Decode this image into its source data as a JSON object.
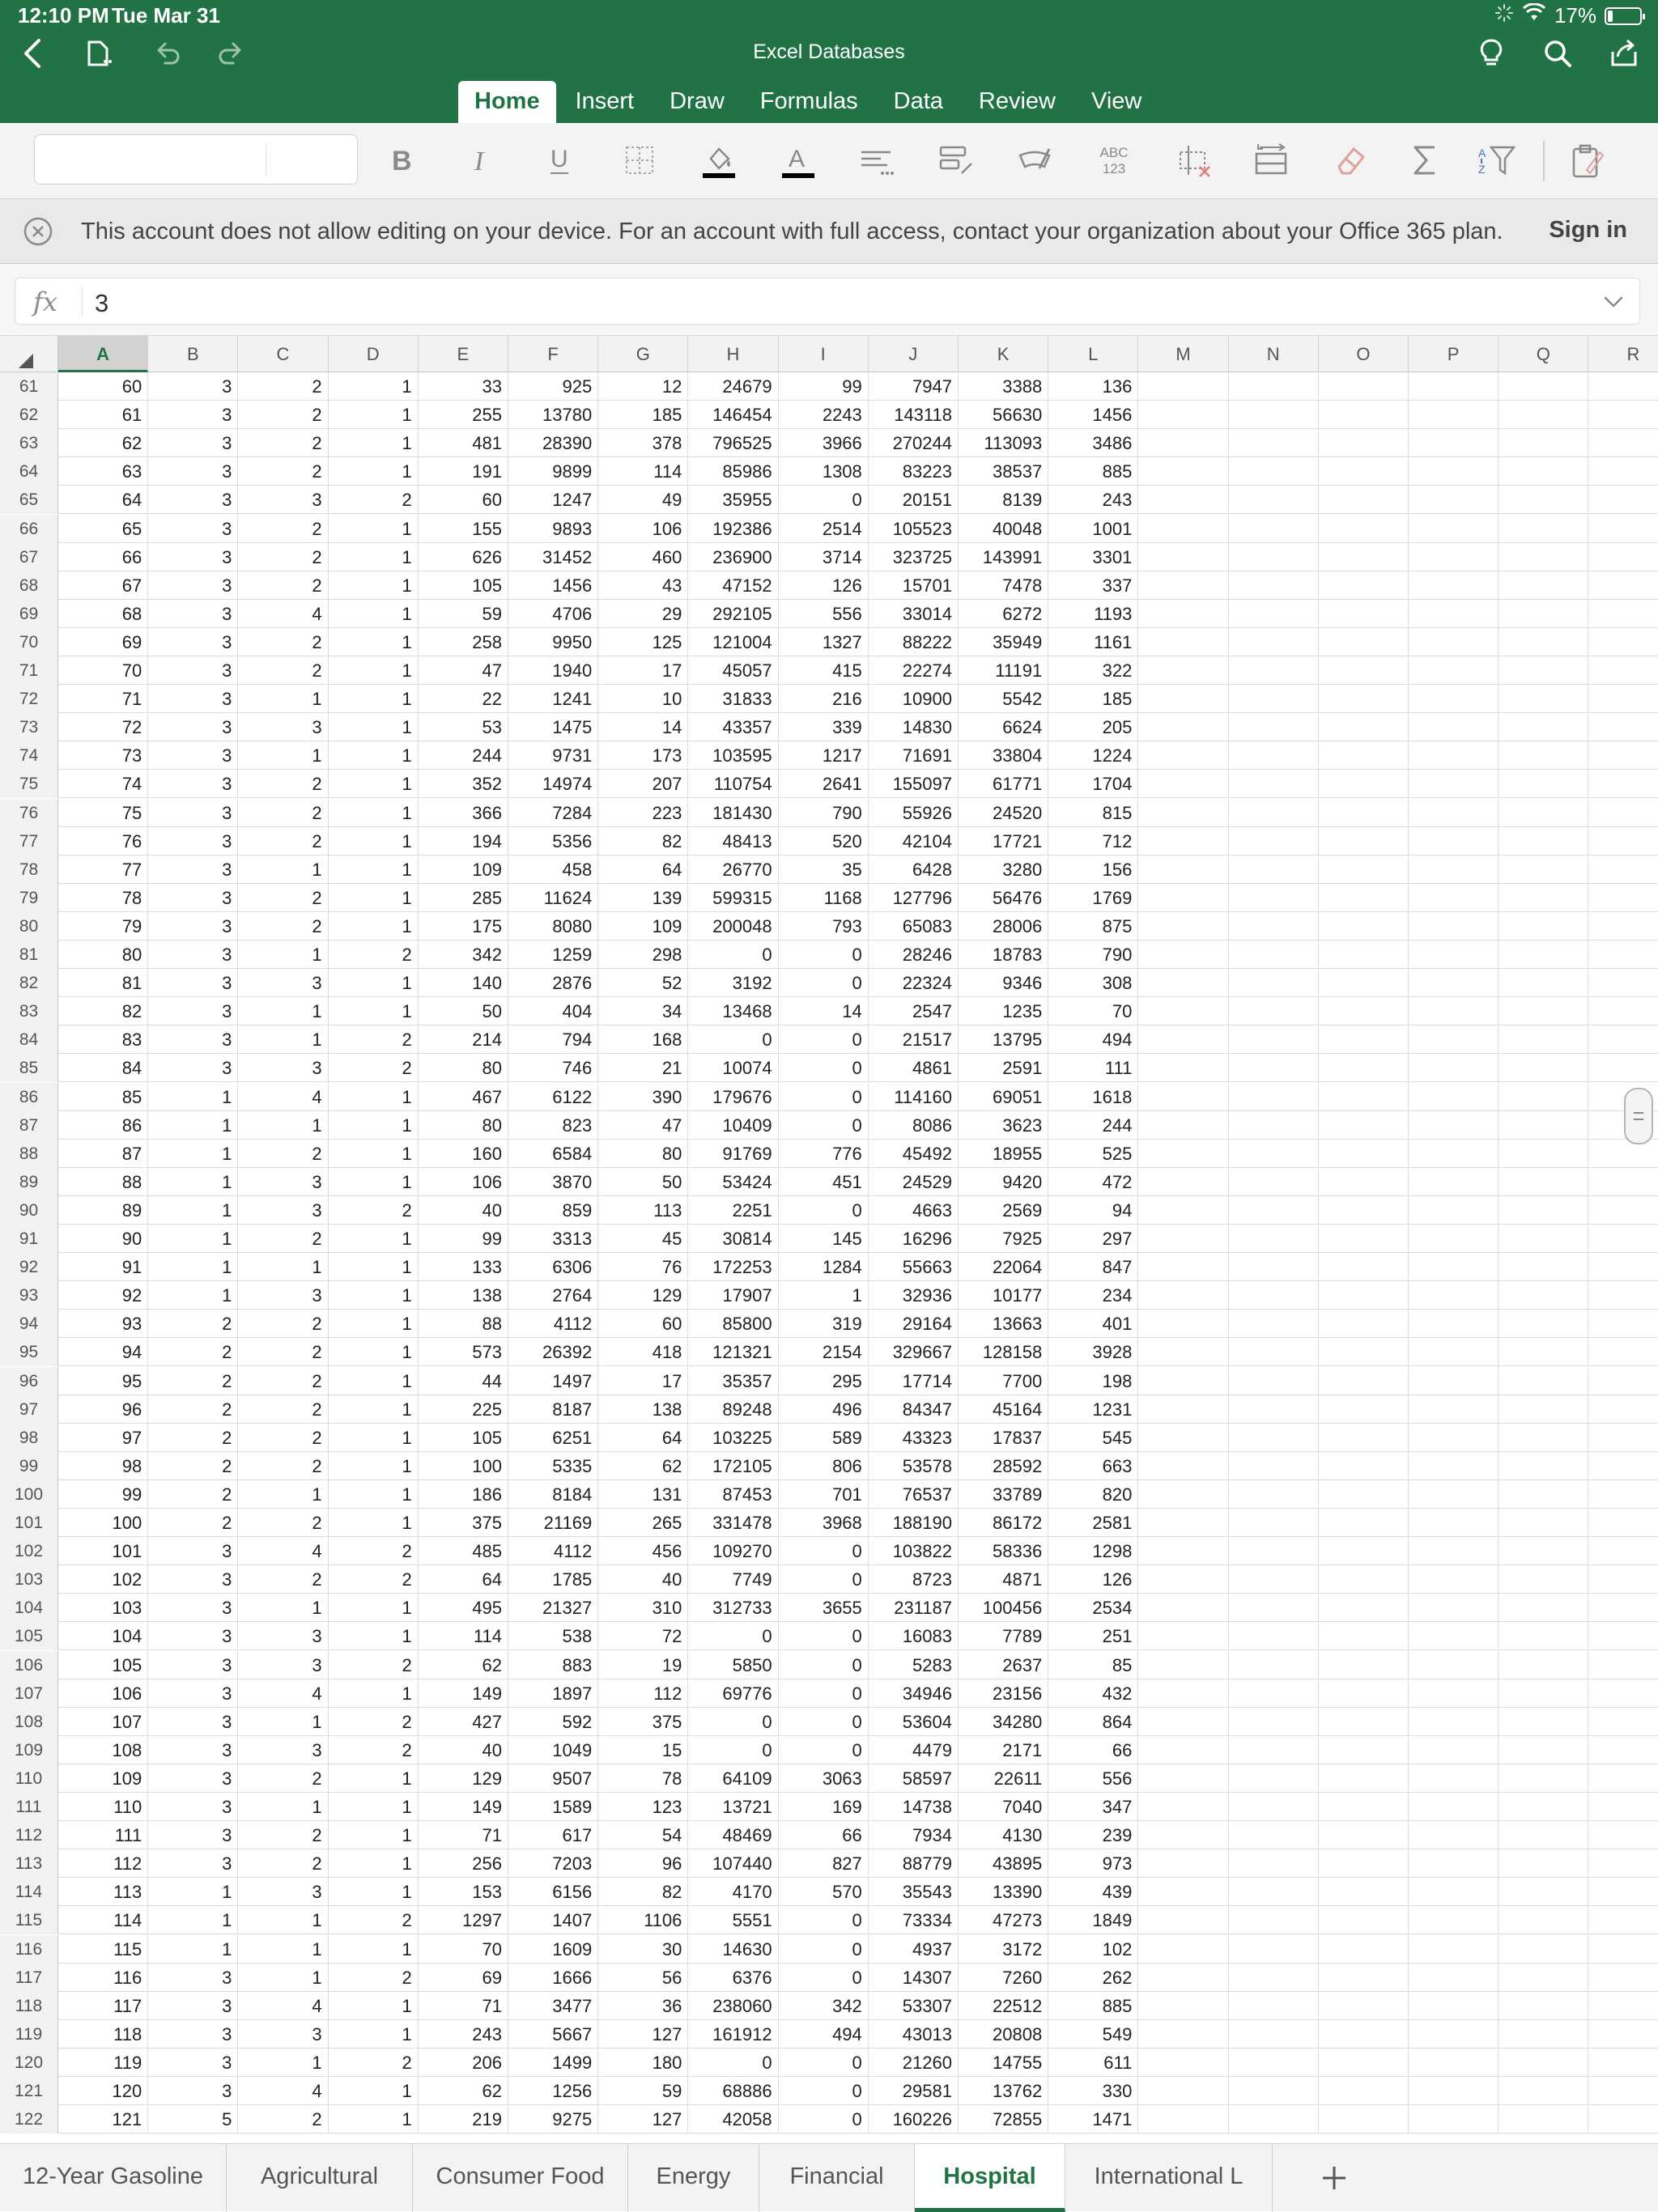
{
  "status_bar": {
    "time": "12:10 PM",
    "date": "Tue Mar 31",
    "battery": "17%",
    "battery_level": 0.17
  },
  "app": {
    "title": "Excel Databases"
  },
  "ribbon": {
    "tabs": [
      "Home",
      "Insert",
      "Draw",
      "Formulas",
      "Data",
      "Review",
      "View"
    ],
    "active": "Home"
  },
  "toolbar": {
    "abc_label_top": "ABC",
    "abc_label_bottom": "123",
    "colors": {
      "fill": "#000000",
      "font": "#000000"
    }
  },
  "notice": {
    "text": "This account does not allow editing on your device. For an account with full access, contact your organization about your Office 365 plan.",
    "sign_in": "Sign in"
  },
  "formula_bar": {
    "fx": "fx",
    "value": "3"
  },
  "grid": {
    "columns": [
      "A",
      "B",
      "C",
      "D",
      "E",
      "F",
      "G",
      "H",
      "I",
      "J",
      "K",
      "L",
      "M",
      "N",
      "O",
      "P",
      "Q",
      "R"
    ],
    "selected_column": "A",
    "rows": [
      {
        "n": 61,
        "v": [
          60,
          3,
          2,
          1,
          33,
          925,
          12,
          24679,
          99,
          7947,
          3388,
          136
        ]
      },
      {
        "n": 62,
        "v": [
          61,
          3,
          2,
          1,
          255,
          13780,
          185,
          146454,
          2243,
          143118,
          56630,
          1456
        ]
      },
      {
        "n": 63,
        "v": [
          62,
          3,
          2,
          1,
          481,
          28390,
          378,
          796525,
          3966,
          270244,
          113093,
          3486
        ]
      },
      {
        "n": 64,
        "v": [
          63,
          3,
          2,
          1,
          191,
          9899,
          114,
          85986,
          1308,
          83223,
          38537,
          885
        ]
      },
      {
        "n": 65,
        "v": [
          64,
          3,
          3,
          2,
          60,
          1247,
          49,
          35955,
          0,
          20151,
          8139,
          243
        ]
      },
      {
        "n": 66,
        "v": [
          65,
          3,
          2,
          1,
          155,
          9893,
          106,
          192386,
          2514,
          105523,
          40048,
          1001
        ]
      },
      {
        "n": 67,
        "v": [
          66,
          3,
          2,
          1,
          626,
          31452,
          460,
          236900,
          3714,
          323725,
          143991,
          3301
        ]
      },
      {
        "n": 68,
        "v": [
          67,
          3,
          2,
          1,
          105,
          1456,
          43,
          47152,
          126,
          15701,
          7478,
          337
        ]
      },
      {
        "n": 69,
        "v": [
          68,
          3,
          4,
          1,
          59,
          4706,
          29,
          292105,
          556,
          33014,
          6272,
          1193
        ]
      },
      {
        "n": 70,
        "v": [
          69,
          3,
          2,
          1,
          258,
          9950,
          125,
          121004,
          1327,
          88222,
          35949,
          1161
        ]
      },
      {
        "n": 71,
        "v": [
          70,
          3,
          2,
          1,
          47,
          1940,
          17,
          45057,
          415,
          22274,
          11191,
          322
        ]
      },
      {
        "n": 72,
        "v": [
          71,
          3,
          1,
          1,
          22,
          1241,
          10,
          31833,
          216,
          10900,
          5542,
          185
        ]
      },
      {
        "n": 73,
        "v": [
          72,
          3,
          3,
          1,
          53,
          1475,
          14,
          43357,
          339,
          14830,
          6624,
          205
        ]
      },
      {
        "n": 74,
        "v": [
          73,
          3,
          1,
          1,
          244,
          9731,
          173,
          103595,
          1217,
          71691,
          33804,
          1224
        ]
      },
      {
        "n": 75,
        "v": [
          74,
          3,
          2,
          1,
          352,
          14974,
          207,
          110754,
          2641,
          155097,
          61771,
          1704
        ]
      },
      {
        "n": 76,
        "v": [
          75,
          3,
          2,
          1,
          366,
          7284,
          223,
          181430,
          790,
          55926,
          24520,
          815
        ]
      },
      {
        "n": 77,
        "v": [
          76,
          3,
          2,
          1,
          194,
          5356,
          82,
          48413,
          520,
          42104,
          17721,
          712
        ]
      },
      {
        "n": 78,
        "v": [
          77,
          3,
          1,
          1,
          109,
          458,
          64,
          26770,
          35,
          6428,
          3280,
          156
        ]
      },
      {
        "n": 79,
        "v": [
          78,
          3,
          2,
          1,
          285,
          11624,
          139,
          599315,
          1168,
          127796,
          56476,
          1769
        ]
      },
      {
        "n": 80,
        "v": [
          79,
          3,
          2,
          1,
          175,
          8080,
          109,
          200048,
          793,
          65083,
          28006,
          875
        ]
      },
      {
        "n": 81,
        "v": [
          80,
          3,
          1,
          2,
          342,
          1259,
          298,
          0,
          0,
          28246,
          18783,
          790
        ]
      },
      {
        "n": 82,
        "v": [
          81,
          3,
          3,
          1,
          140,
          2876,
          52,
          3192,
          0,
          22324,
          9346,
          308
        ]
      },
      {
        "n": 83,
        "v": [
          82,
          3,
          1,
          1,
          50,
          404,
          34,
          13468,
          14,
          2547,
          1235,
          70
        ]
      },
      {
        "n": 84,
        "v": [
          83,
          3,
          1,
          2,
          214,
          794,
          168,
          0,
          0,
          21517,
          13795,
          494
        ]
      },
      {
        "n": 85,
        "v": [
          84,
          3,
          3,
          2,
          80,
          746,
          21,
          10074,
          0,
          4861,
          2591,
          111
        ]
      },
      {
        "n": 86,
        "v": [
          85,
          1,
          4,
          1,
          467,
          6122,
          390,
          179676,
          0,
          114160,
          69051,
          1618
        ]
      },
      {
        "n": 87,
        "v": [
          86,
          1,
          1,
          1,
          80,
          823,
          47,
          10409,
          0,
          8086,
          3623,
          244
        ]
      },
      {
        "n": 88,
        "v": [
          87,
          1,
          2,
          1,
          160,
          6584,
          80,
          91769,
          776,
          45492,
          18955,
          525
        ]
      },
      {
        "n": 89,
        "v": [
          88,
          1,
          3,
          1,
          106,
          3870,
          50,
          53424,
          451,
          24529,
          9420,
          472
        ]
      },
      {
        "n": 90,
        "v": [
          89,
          1,
          3,
          2,
          40,
          859,
          113,
          2251,
          0,
          4663,
          2569,
          94
        ]
      },
      {
        "n": 91,
        "v": [
          90,
          1,
          2,
          1,
          99,
          3313,
          45,
          30814,
          145,
          16296,
          7925,
          297
        ]
      },
      {
        "n": 92,
        "v": [
          91,
          1,
          1,
          1,
          133,
          6306,
          76,
          172253,
          1284,
          55663,
          22064,
          847
        ]
      },
      {
        "n": 93,
        "v": [
          92,
          1,
          3,
          1,
          138,
          2764,
          129,
          17907,
          1,
          32936,
          10177,
          234
        ]
      },
      {
        "n": 94,
        "v": [
          93,
          2,
          2,
          1,
          88,
          4112,
          60,
          85800,
          319,
          29164,
          13663,
          401
        ]
      },
      {
        "n": 95,
        "v": [
          94,
          2,
          2,
          1,
          573,
          26392,
          418,
          121321,
          2154,
          329667,
          128158,
          3928
        ]
      },
      {
        "n": 96,
        "v": [
          95,
          2,
          2,
          1,
          44,
          1497,
          17,
          35357,
          295,
          17714,
          7700,
          198
        ]
      },
      {
        "n": 97,
        "v": [
          96,
          2,
          2,
          1,
          225,
          8187,
          138,
          89248,
          496,
          84347,
          45164,
          1231
        ]
      },
      {
        "n": 98,
        "v": [
          97,
          2,
          2,
          1,
          105,
          6251,
          64,
          103225,
          589,
          43323,
          17837,
          545
        ]
      },
      {
        "n": 99,
        "v": [
          98,
          2,
          2,
          1,
          100,
          5335,
          62,
          172105,
          806,
          53578,
          28592,
          663
        ]
      },
      {
        "n": 100,
        "v": [
          99,
          2,
          1,
          1,
          186,
          8184,
          131,
          87453,
          701,
          76537,
          33789,
          820
        ]
      },
      {
        "n": 101,
        "v": [
          100,
          2,
          2,
          1,
          375,
          21169,
          265,
          331478,
          3968,
          188190,
          86172,
          2581
        ]
      },
      {
        "n": 102,
        "v": [
          101,
          3,
          4,
          2,
          485,
          4112,
          456,
          109270,
          0,
          103822,
          58336,
          1298
        ]
      },
      {
        "n": 103,
        "v": [
          102,
          3,
          2,
          2,
          64,
          1785,
          40,
          7749,
          0,
          8723,
          4871,
          126
        ]
      },
      {
        "n": 104,
        "v": [
          103,
          3,
          1,
          1,
          495,
          21327,
          310,
          312733,
          3655,
          231187,
          100456,
          2534
        ]
      },
      {
        "n": 105,
        "v": [
          104,
          3,
          3,
          1,
          114,
          538,
          72,
          0,
          0,
          16083,
          7789,
          251
        ]
      },
      {
        "n": 106,
        "v": [
          105,
          3,
          3,
          2,
          62,
          883,
          19,
          5850,
          0,
          5283,
          2637,
          85
        ]
      },
      {
        "n": 107,
        "v": [
          106,
          3,
          4,
          1,
          149,
          1897,
          112,
          69776,
          0,
          34946,
          23156,
          432
        ]
      },
      {
        "n": 108,
        "v": [
          107,
          3,
          1,
          2,
          427,
          592,
          375,
          0,
          0,
          53604,
          34280,
          864
        ]
      },
      {
        "n": 109,
        "v": [
          108,
          3,
          3,
          2,
          40,
          1049,
          15,
          0,
          0,
          4479,
          2171,
          66
        ]
      },
      {
        "n": 110,
        "v": [
          109,
          3,
          2,
          1,
          129,
          9507,
          78,
          64109,
          3063,
          58597,
          22611,
          556
        ]
      },
      {
        "n": 111,
        "v": [
          110,
          3,
          1,
          1,
          149,
          1589,
          123,
          13721,
          169,
          14738,
          7040,
          347
        ]
      },
      {
        "n": 112,
        "v": [
          111,
          3,
          2,
          1,
          71,
          617,
          54,
          48469,
          66,
          7934,
          4130,
          239
        ]
      },
      {
        "n": 113,
        "v": [
          112,
          3,
          2,
          1,
          256,
          7203,
          96,
          107440,
          827,
          88779,
          43895,
          973
        ]
      },
      {
        "n": 114,
        "v": [
          113,
          1,
          3,
          1,
          153,
          6156,
          82,
          4170,
          570,
          35543,
          13390,
          439
        ]
      },
      {
        "n": 115,
        "v": [
          114,
          1,
          1,
          2,
          1297,
          1407,
          1106,
          5551,
          0,
          73334,
          47273,
          1849
        ]
      },
      {
        "n": 116,
        "v": [
          115,
          1,
          1,
          1,
          70,
          1609,
          30,
          14630,
          0,
          4937,
          3172,
          102
        ]
      },
      {
        "n": 117,
        "v": [
          116,
          3,
          1,
          2,
          69,
          1666,
          56,
          6376,
          0,
          14307,
          7260,
          262
        ]
      },
      {
        "n": 118,
        "v": [
          117,
          3,
          4,
          1,
          71,
          3477,
          36,
          238060,
          342,
          53307,
          22512,
          885
        ]
      },
      {
        "n": 119,
        "v": [
          118,
          3,
          3,
          1,
          243,
          5667,
          127,
          161912,
          494,
          43013,
          20808,
          549
        ]
      },
      {
        "n": 120,
        "v": [
          119,
          3,
          1,
          2,
          206,
          1499,
          180,
          0,
          0,
          21260,
          14755,
          611
        ]
      },
      {
        "n": 121,
        "v": [
          120,
          3,
          4,
          1,
          62,
          1256,
          59,
          68886,
          0,
          29581,
          13762,
          330
        ]
      },
      {
        "n": 122,
        "v": [
          121,
          5,
          2,
          1,
          219,
          9275,
          127,
          42058,
          0,
          160226,
          72855,
          1471
        ]
      }
    ]
  },
  "sheets": {
    "tabs": [
      "12-Year Gasoline",
      "Agricultural",
      "Consumer Food",
      "Energy",
      "Financial",
      "Hospital",
      "International L"
    ],
    "active": "Hospital"
  },
  "theme": {
    "accent": "#217346"
  }
}
